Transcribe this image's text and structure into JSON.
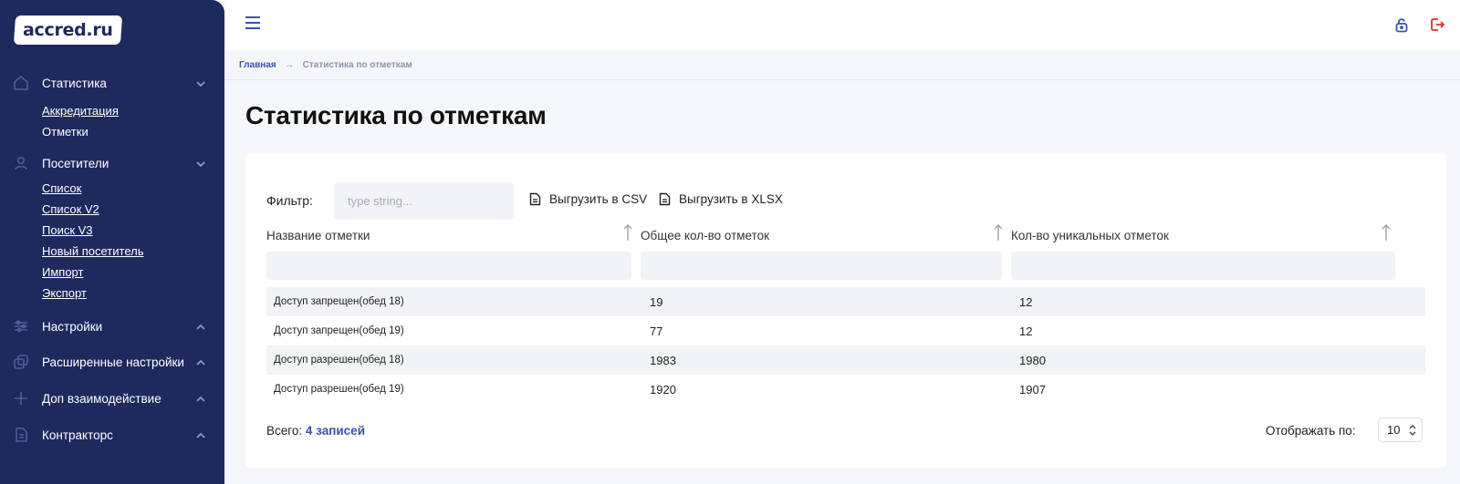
{
  "logo": "accred.ru",
  "sidebar": {
    "groups": [
      {
        "label": "Статистика",
        "icon": "home-icon",
        "chevron": "down",
        "items": [
          {
            "label": "Аккредитация"
          },
          {
            "label": "Отметки"
          }
        ]
      },
      {
        "label": "Посетители",
        "icon": "user-icon",
        "chevron": "down",
        "items": [
          {
            "label": "Список"
          },
          {
            "label": "Список V2"
          },
          {
            "label": "Поиск V3"
          },
          {
            "label": "Новый посетитель"
          },
          {
            "label": "Импорт"
          },
          {
            "label": "Экспорт"
          }
        ]
      },
      {
        "label": "Настройки",
        "icon": "sliders-icon",
        "chevron": "up"
      },
      {
        "label": "Расширенные настройки",
        "icon": "copy-icon",
        "chevron": "up"
      },
      {
        "label": "Доп взаимодействие",
        "icon": "plus-icon",
        "chevron": "up"
      },
      {
        "label": "Контракторс",
        "icon": "document-icon",
        "chevron": "up"
      }
    ]
  },
  "topbar": {
    "menu_icon": "hamburger-icon",
    "right_icons": [
      "unlock-icon",
      "logout-icon"
    ]
  },
  "breadcrumb": {
    "home": "Главная",
    "current": "Статистика по отметкам"
  },
  "page": {
    "title": "Статистика по отметкам"
  },
  "filter": {
    "label": "Фильтр:",
    "placeholder": "type string...",
    "export_csv": "Выгрузить в CSV",
    "export_xlsx": "Выгрузить в XLSX"
  },
  "table": {
    "columns": [
      "Название отметки",
      "Общее кол-во отметок",
      "Кол-во уникальных отметок"
    ],
    "rows": [
      {
        "name": "Доступ запрещен(обед 18)",
        "total": "19",
        "unique": "12"
      },
      {
        "name": "Доступ запрещен(обед 19)",
        "total": "77",
        "unique": "12"
      },
      {
        "name": "Доступ разрешен(обед 18)",
        "total": "1983",
        "unique": "1980"
      },
      {
        "name": "Доступ разрешен(обед 19)",
        "total": "1920",
        "unique": "1907"
      }
    ]
  },
  "footer": {
    "total_label": "Всего:",
    "total_count": "4 записей",
    "per_page_label": "Отображать по:",
    "per_page_value": "10"
  },
  "colors": {
    "sidebar_bg": "#1e2a5e",
    "accent": "#3a4fb0",
    "logout": "#d9332b"
  }
}
